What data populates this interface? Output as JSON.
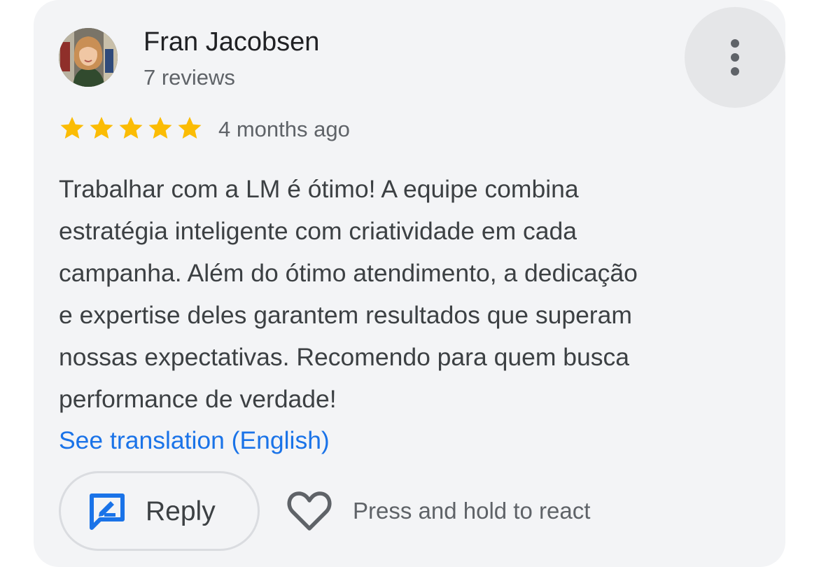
{
  "review": {
    "author_name": "Fran Jacobsen",
    "review_count": "7 reviews",
    "rating": 5,
    "rating_max": 5,
    "timestamp": "4 months ago",
    "text_lines": [
      "Trabalhar com a LM é ótimo! A equipe combina",
      "estratégia inteligente com criatividade em cada",
      "campanha. Além do ótimo atendimento, a dedicação",
      "e expertise deles garantem resultados que superam",
      "nossas expectativas. Recomendo para quem busca",
      "performance de verdade!"
    ],
    "translate_link": "See translation (English)"
  },
  "actions": {
    "reply_label": "Reply",
    "react_hint": "Press and hold to react"
  },
  "icons": {
    "more": "more-vert-icon",
    "star": "star-icon",
    "reply": "reply-icon",
    "heart": "heart-outline-icon"
  },
  "colors": {
    "card_background": "#f3f4f6",
    "star": "#fbbc04",
    "link": "#1a73e8",
    "reply_icon": "#1a73e8",
    "primary_text": "#202124",
    "secondary_text": "#5f6368"
  }
}
